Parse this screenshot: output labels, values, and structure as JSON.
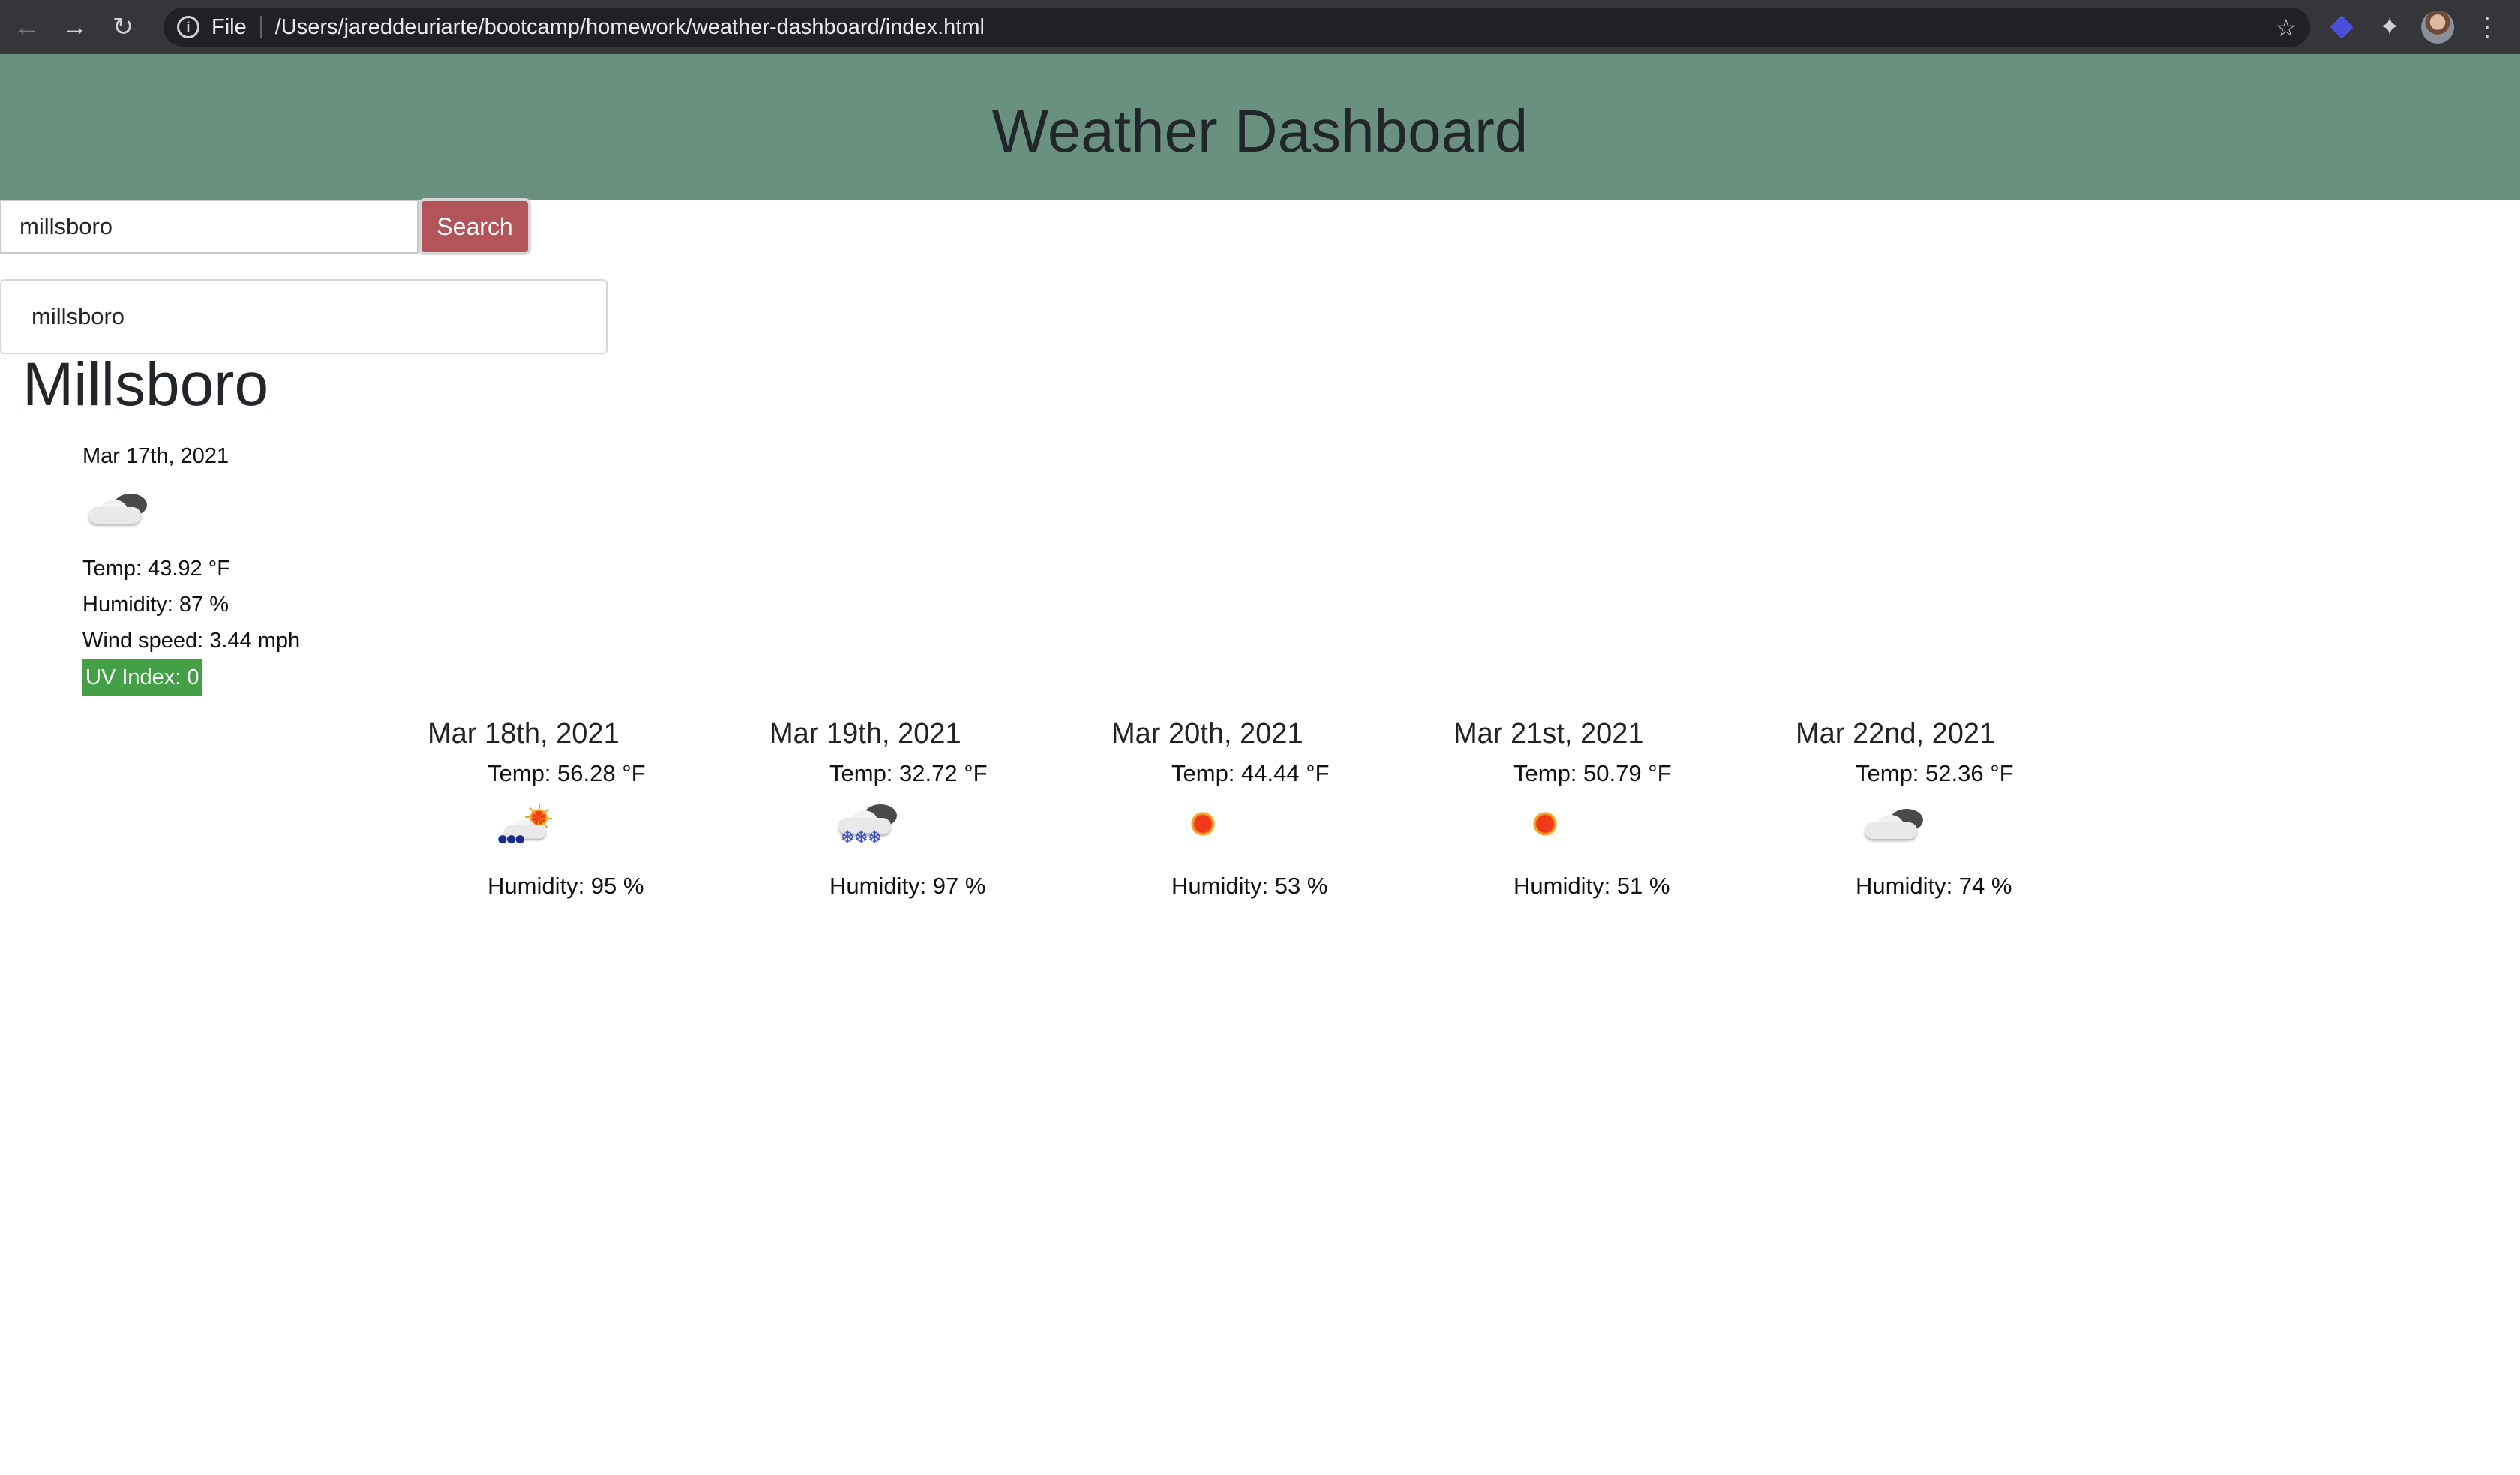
{
  "browser": {
    "scheme_label": "File",
    "url": "/Users/jareddeuriarte/bootcamp/homework/weather-dashboard/index.html"
  },
  "header": {
    "title": "Weather Dashboard"
  },
  "search": {
    "value": "millsboro",
    "button_label": "Search"
  },
  "history": [
    "millsboro"
  ],
  "current": {
    "city": "Millsboro",
    "date": "Mar 17th, 2021",
    "icon": "partly-cloudy-icon",
    "temp": "Temp: 43.92 °F",
    "humidity": "Humidity: 87 %",
    "wind": "Wind speed: 3.44 mph",
    "uv": "UV Index: 0",
    "uv_color": "#43a047"
  },
  "forecast": [
    {
      "date": "Mar 18th, 2021",
      "temp": "Temp: 56.28 °F",
      "icon": "rain-sun-icon",
      "humidity": "Humidity: 95 %"
    },
    {
      "date": "Mar 19th, 2021",
      "temp": "Temp: 32.72 °F",
      "icon": "snow-cloud-icon",
      "humidity": "Humidity: 97 %"
    },
    {
      "date": "Mar 20th, 2021",
      "temp": "Temp: 44.44 °F",
      "icon": "sun-icon",
      "humidity": "Humidity: 53 %"
    },
    {
      "date": "Mar 21st, 2021",
      "temp": "Temp: 50.79 °F",
      "icon": "sun-icon",
      "humidity": "Humidity: 51 %"
    },
    {
      "date": "Mar 22nd, 2021",
      "temp": "Temp: 52.36 °F",
      "icon": "partly-cloudy-icon",
      "humidity": "Humidity: 74 %"
    }
  ],
  "colors": {
    "header_bg": "#6a917f",
    "search_button": "#b2545a"
  }
}
